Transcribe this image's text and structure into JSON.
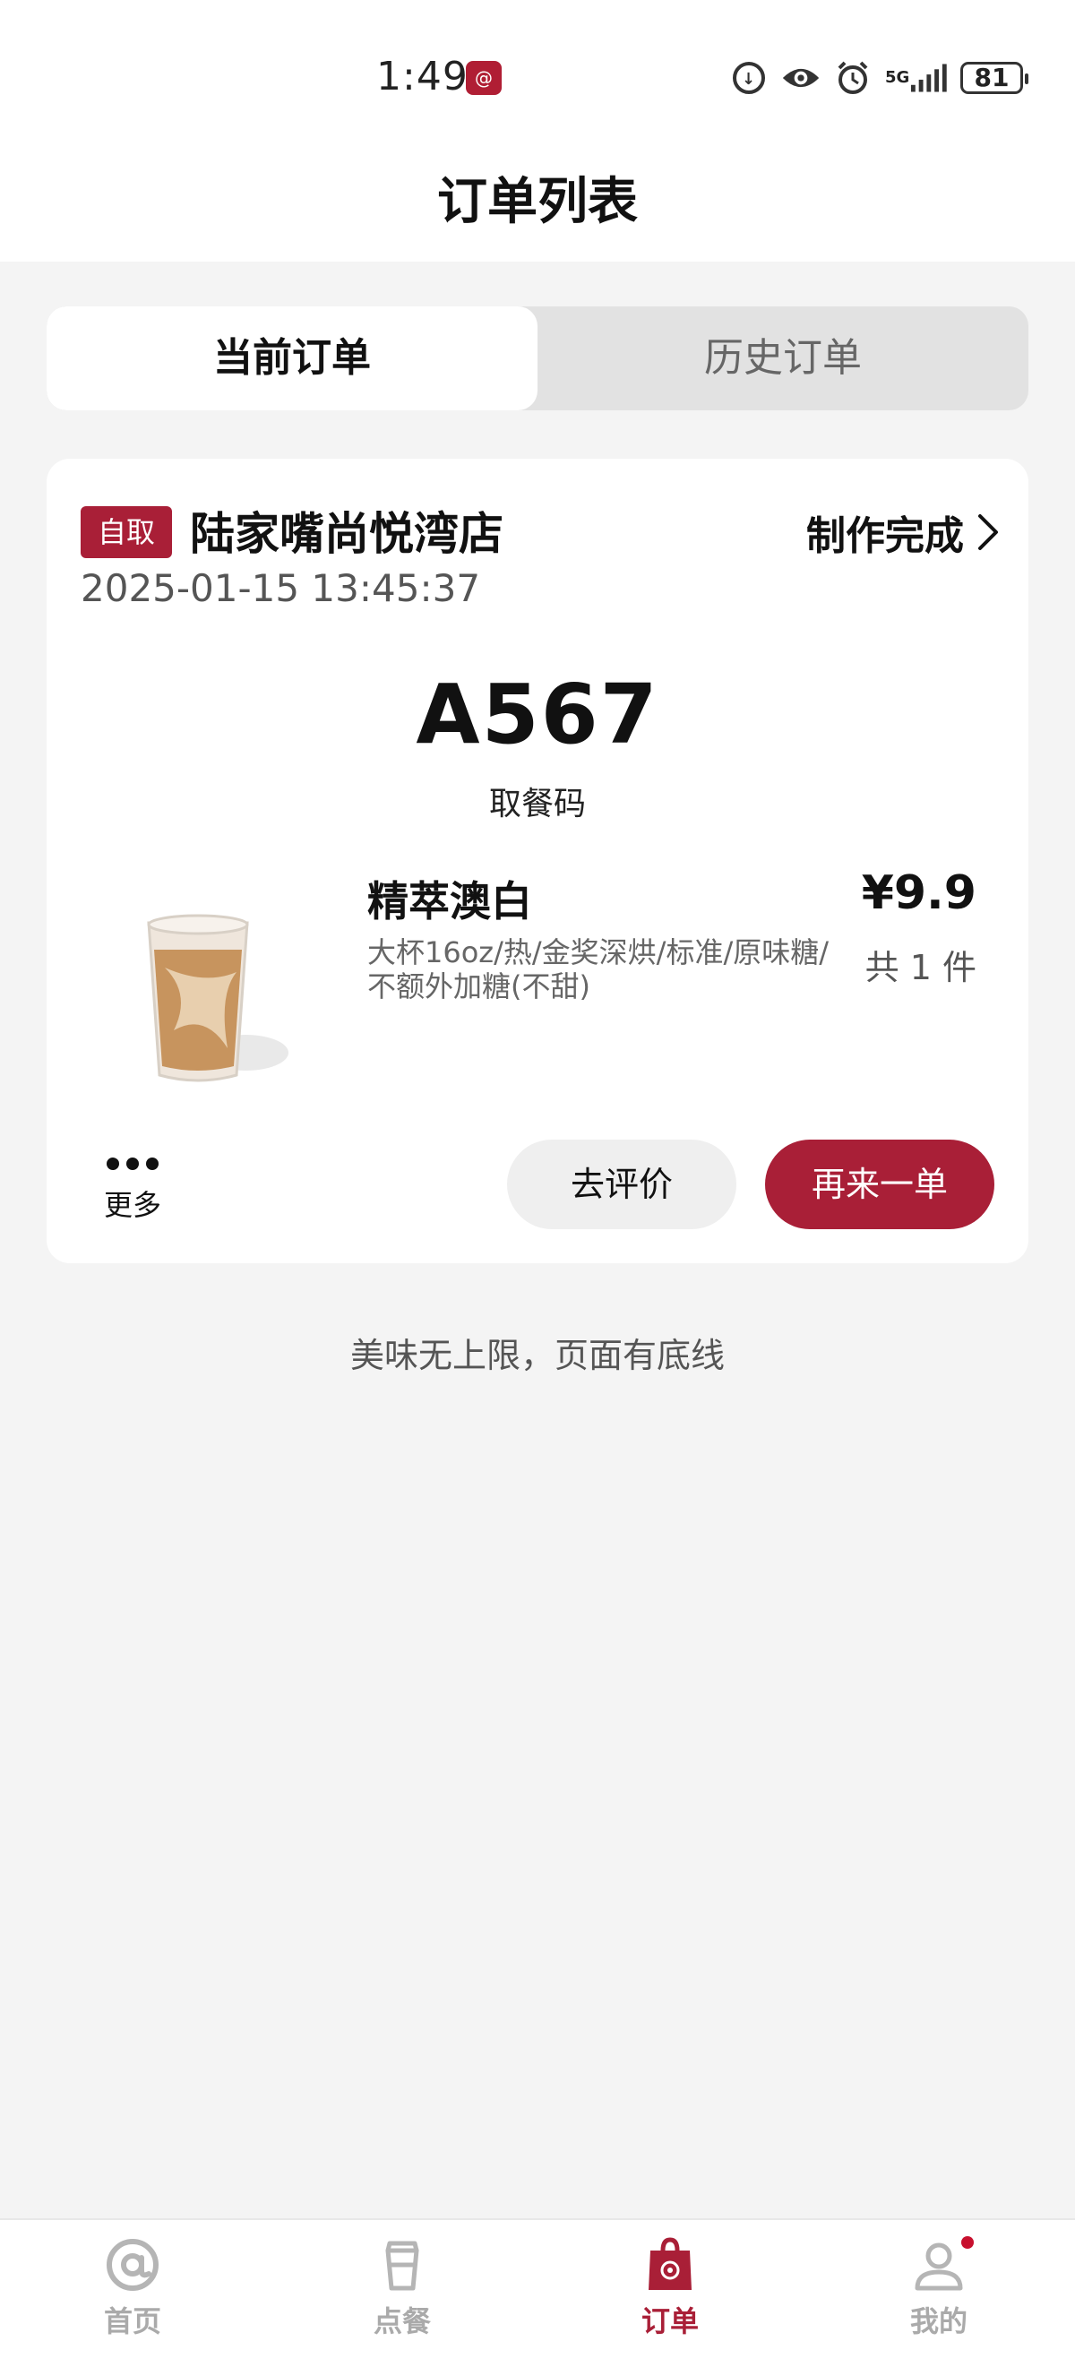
{
  "status_bar": {
    "time": "1:49",
    "app_icon": "@",
    "network": "5G",
    "battery": "81",
    "icons": [
      "data-saver-icon",
      "eye-icon",
      "alarm-icon",
      "signal-icon",
      "battery-icon"
    ]
  },
  "header": {
    "title": "订单列表"
  },
  "tabs": [
    {
      "label": "当前订单",
      "active": true
    },
    {
      "label": "历史订单",
      "active": false
    }
  ],
  "order": {
    "type_badge": "自取",
    "store_name": "陆家嘴尚悦湾店",
    "status": "制作完成",
    "datetime": "2025-01-15 13:45:37",
    "pickup_code": "A567",
    "pickup_label": "取餐码",
    "item": {
      "name": "精萃澳白",
      "specs": "大杯16oz/热/金奖深烘/标准/原味糖/不额外加糖(不甜)",
      "price": "¥9.9",
      "quantity": "共 1 件"
    },
    "more_label": "更多",
    "review_button": "去评价",
    "reorder_button": "再来一单"
  },
  "footer_note": "美味无上限，页面有底线",
  "bottom_nav": {
    "active_color": "#a91f37",
    "items": [
      {
        "label": "首页",
        "icon": "home-at-icon",
        "active": false
      },
      {
        "label": "点餐",
        "icon": "cup-icon",
        "active": false
      },
      {
        "label": "订单",
        "icon": "bag-icon",
        "active": true
      },
      {
        "label": "我的",
        "icon": "profile-icon",
        "active": false,
        "dot": true
      }
    ]
  }
}
